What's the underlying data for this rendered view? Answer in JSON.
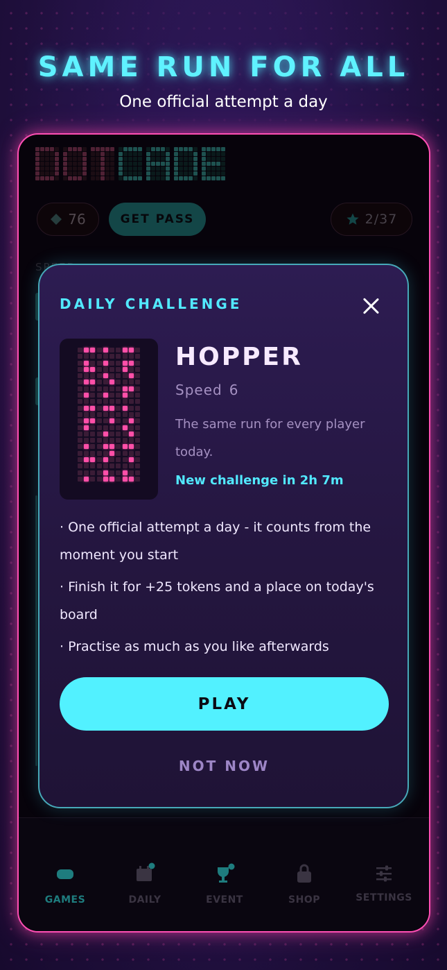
{
  "promo": {
    "headline": "SAME RUN FOR ALL",
    "subhead": "One official attempt a day"
  },
  "app": {
    "logo_text": "DOTCADE",
    "tokens": "76",
    "get_pass_label": "GET PASS",
    "stars": "2/37",
    "bg_label": "SPEED"
  },
  "modal": {
    "title": "DAILY CHALLENGE",
    "game_name": "HOPPER",
    "speed_label": "Speed",
    "speed_value": "6",
    "description": "The same run for every player today.",
    "timer": "New challenge in 2h 7m",
    "bullets": [
      "· One official attempt a day - it counts from the moment you start",
      "· Finish it for +25 tokens and a place on today's board",
      "· Practise as much as you like afterwards"
    ],
    "play_label": "PLAY",
    "not_now_label": "NOT NOW"
  },
  "nav": {
    "items": [
      {
        "label": "GAMES",
        "icon": "gamepad-icon",
        "active": true
      },
      {
        "label": "DAILY",
        "icon": "calendar-icon",
        "active": false
      },
      {
        "label": "EVENT",
        "icon": "trophy-icon",
        "active": false
      },
      {
        "label": "SHOP",
        "icon": "bag-icon",
        "active": false
      },
      {
        "label": "SETTINGS",
        "icon": "sliders-icon",
        "active": false
      }
    ]
  },
  "colors": {
    "accent_cyan": "#52f1ff",
    "accent_pink": "#ff4fb4",
    "modal_bg": "#2d1c52"
  }
}
